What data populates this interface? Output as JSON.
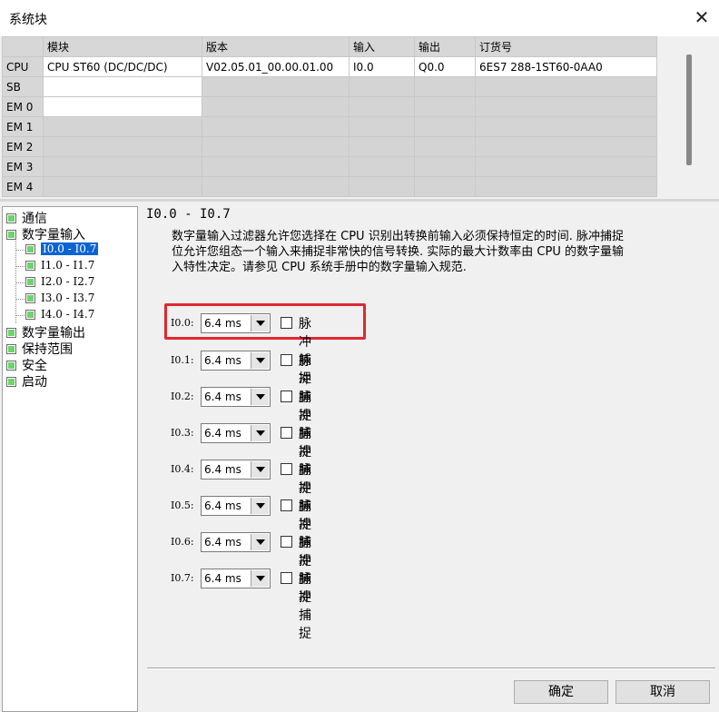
{
  "window": {
    "title": "系统块",
    "close_glyph": "✕"
  },
  "module_table": {
    "headers": [
      "",
      "模块",
      "版本",
      "输入",
      "输出",
      "订货号"
    ],
    "rows": [
      {
        "slot": "CPU",
        "module": "CPU ST60 (DC/DC/DC)",
        "version": "V02.05.01_00.00.01.00",
        "input": "I0.0",
        "output": "Q0.0",
        "order": "6ES7 288-1ST60-0AA0"
      },
      {
        "slot": "SB",
        "module": "",
        "version": "",
        "input": "",
        "output": "",
        "order": ""
      },
      {
        "slot": "EM 0",
        "module": "",
        "version": "",
        "input": "",
        "output": "",
        "order": ""
      },
      {
        "slot": "EM 1",
        "module": "",
        "version": "",
        "input": "",
        "output": "",
        "order": ""
      },
      {
        "slot": "EM 2",
        "module": "",
        "version": "",
        "input": "",
        "output": "",
        "order": ""
      },
      {
        "slot": "EM 3",
        "module": "",
        "version": "",
        "input": "",
        "output": "",
        "order": ""
      },
      {
        "slot": "EM 4",
        "module": "",
        "version": "",
        "input": "",
        "output": "",
        "order": ""
      }
    ]
  },
  "tree": {
    "items": [
      {
        "label": "通信"
      },
      {
        "label": "数字量输入"
      },
      {
        "label": "I0.0 - I0.7",
        "selected": true
      },
      {
        "label": "I1.0 - I1.7"
      },
      {
        "label": "I2.0 - I2.7"
      },
      {
        "label": "I3.0 - I3.7"
      },
      {
        "label": "I4.0 - I4.7"
      },
      {
        "label": "数字量输出"
      },
      {
        "label": "保持范围"
      },
      {
        "label": "安全"
      },
      {
        "label": "启动"
      }
    ],
    "node_color": "#6cd46c",
    "selection_color": "#0a64d2"
  },
  "content": {
    "heading": "I0.0 - I0.7",
    "description_lines": [
      "数字量输入过滤器允许您选择在 CPU 识别出转换前输入必须保持恒定的时间. 脉冲捕捉",
      "位允许您组态一个输入来捕捉非常快的信号转换. 实际的最大计数率由 CPU 的数字量输",
      "入特性决定。请参见 CPU 系统手册中的数字量输入规范."
    ],
    "inputs": [
      {
        "label": "I0.0:",
        "filter": "6.4 ms",
        "pulse_label": "脉冲捕捉"
      },
      {
        "label": "I0.1:",
        "filter": "6.4 ms",
        "pulse_label": "脉冲捕捉"
      },
      {
        "label": "I0.2:",
        "filter": "6.4 ms",
        "pulse_label": "脉冲捕捉"
      },
      {
        "label": "I0.3:",
        "filter": "6.4 ms",
        "pulse_label": "脉冲捕捉"
      },
      {
        "label": "I0.4:",
        "filter": "6.4 ms",
        "pulse_label": "脉冲捕捉"
      },
      {
        "label": "I0.5:",
        "filter": "6.4 ms",
        "pulse_label": "脉冲捕捉"
      },
      {
        "label": "I0.6:",
        "filter": "6.4 ms",
        "pulse_label": "脉冲捕捉"
      },
      {
        "label": "I0.7:",
        "filter": "6.4 ms",
        "pulse_label": "脉冲捕捉"
      }
    ],
    "highlight_color": "#e0282e"
  },
  "buttons": {
    "ok": "确定",
    "cancel": "取消"
  }
}
